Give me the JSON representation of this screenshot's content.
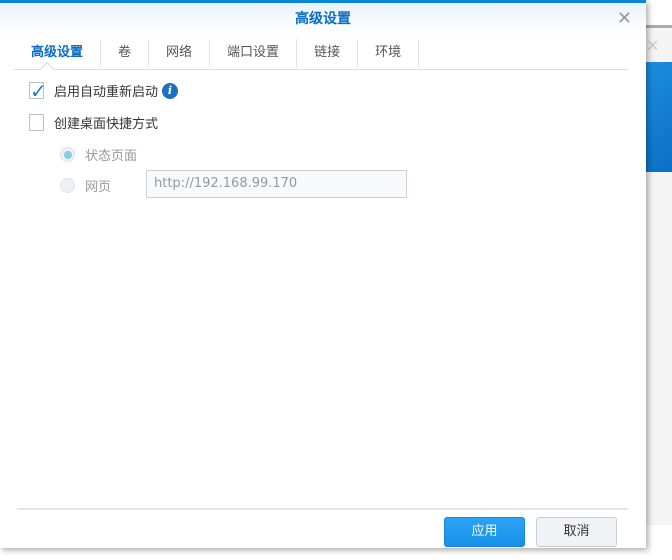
{
  "dialog": {
    "title": "高级设置",
    "close_icon": "close-icon"
  },
  "tabs": [
    {
      "label": "高级设置",
      "active": true
    },
    {
      "label": "卷"
    },
    {
      "label": "网络"
    },
    {
      "label": "端口设置"
    },
    {
      "label": "链接"
    },
    {
      "label": "环境"
    }
  ],
  "options": {
    "auto_restart": {
      "label": "启用自动重新启动",
      "checked": true
    },
    "shortcut": {
      "label": "创建桌面快捷方式",
      "checked": false
    },
    "radio_status": {
      "label": "状态页面",
      "selected": true
    },
    "radio_web": {
      "label": "网页",
      "selected": false
    },
    "url_value": "http://192.168.99.170"
  },
  "footer": {
    "apply": "应用",
    "cancel": "取消"
  },
  "colors": {
    "accent": "#0a84d9",
    "apply_button": "#1a90e8"
  }
}
